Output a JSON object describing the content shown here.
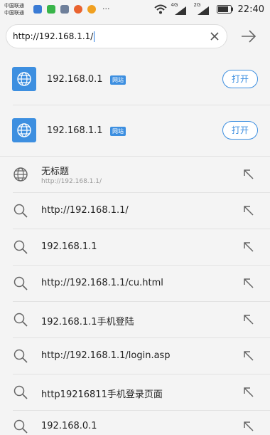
{
  "status_bar": {
    "carrier_1": "中国联通",
    "carrier_2": "中国联通",
    "overflow": "···",
    "net_1": "4G",
    "net_2": "2G",
    "time": "22:40",
    "app_icon_colors": [
      "#3a7bd5",
      "#39b54a",
      "#6e7f9a",
      "#e9632f",
      "#f0a020"
    ]
  },
  "address_bar": {
    "value": "http://192.168.1.1/",
    "clear_icon": "close-icon",
    "go_icon": "arrow-right-icon"
  },
  "sites": [
    {
      "name": "192.168.0.1",
      "tag": "网站",
      "button": "打开"
    },
    {
      "name": "192.168.1.1",
      "tag": "网站",
      "button": "打开"
    }
  ],
  "suggestions": [
    {
      "type": "history",
      "icon": "globe-icon",
      "title": "无标题",
      "subtitle": "http://192.168.1.1/"
    },
    {
      "type": "search",
      "icon": "search-icon",
      "title": "http://192.168.1.1/"
    },
    {
      "type": "search",
      "icon": "search-icon",
      "title": "192.168.1.1"
    },
    {
      "type": "search",
      "icon": "search-icon",
      "title": "http://192.168.1.1/cu.html"
    },
    {
      "type": "search",
      "icon": "search-icon",
      "title": "192.168.1.1手机登陆"
    },
    {
      "type": "search",
      "icon": "search-icon",
      "title": "http://192.168.1.1/login.asp"
    },
    {
      "type": "search",
      "icon": "search-icon",
      "title": "http19216811手机登录页面"
    },
    {
      "type": "search",
      "icon": "search-icon",
      "title": "192.168.0.1"
    }
  ],
  "colors": {
    "accent": "#3d8fe0",
    "background": "#f4f4f4"
  }
}
